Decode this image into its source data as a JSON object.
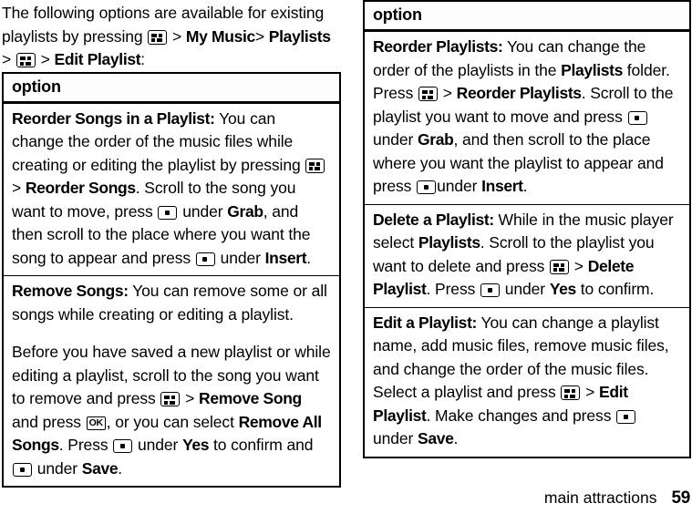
{
  "page": {
    "footer": {
      "chapter": "main attractions",
      "page_number": "59"
    }
  },
  "icons": {
    "menu": "menu-key-icon",
    "center_select": "center-select-key-icon",
    "ok": "ok-key-icon",
    "ok_label": "OK"
  },
  "intro": {
    "t1": "The following options are available for existing playlists by pressing ",
    "t2": " > ",
    "b1": "My Music",
    "t3": "> ",
    "b2": "Playlists",
    "t4": " > ",
    "t5": " > ",
    "b3": "Edit Playlist",
    "t6": ":"
  },
  "tables": {
    "left": {
      "header": "option",
      "rows": [
        {
          "title": "Reorder Songs in a Playlist:",
          "paragraphs": [
            {
              "parts": [
                {
                  "type": "text",
                  "value": " You can change the order of the music files while creating or editing the playlist by pressing "
                },
                {
                  "type": "icon",
                  "value": "menu"
                },
                {
                  "type": "text",
                  "value": " > "
                },
                {
                  "type": "bold",
                  "value": "Reorder Songs"
                },
                {
                  "type": "text",
                  "value": ". Scroll to the song you want to move, press "
                },
                {
                  "type": "icon",
                  "value": "center_select"
                },
                {
                  "type": "text",
                  "value": " under "
                },
                {
                  "type": "bold",
                  "value": "Grab"
                },
                {
                  "type": "text",
                  "value": ", and then scroll to the place where you want the song to appear and press "
                },
                {
                  "type": "icon",
                  "value": "center_select"
                },
                {
                  "type": "text",
                  "value": " under "
                },
                {
                  "type": "bold",
                  "value": "Insert"
                },
                {
                  "type": "text",
                  "value": "."
                }
              ]
            }
          ]
        },
        {
          "title": "Remove Songs:",
          "paragraphs": [
            {
              "parts": [
                {
                  "type": "text",
                  "value": " You can remove some or all songs while creating or editing a playlist."
                }
              ]
            },
            {
              "parts": [
                {
                  "type": "text",
                  "value": "Before you have saved a new playlist or while editing a playlist, scroll to the song you want to remove and press "
                },
                {
                  "type": "icon",
                  "value": "menu"
                },
                {
                  "type": "text",
                  "value": " > "
                },
                {
                  "type": "bold",
                  "value": "Remove Song"
                },
                {
                  "type": "text",
                  "value": " and press "
                },
                {
                  "type": "icon",
                  "value": "ok"
                },
                {
                  "type": "text",
                  "value": ", or you can select "
                },
                {
                  "type": "bold",
                  "value": "Remove All Songs"
                },
                {
                  "type": "text",
                  "value": ". Press "
                },
                {
                  "type": "icon",
                  "value": "center_select"
                },
                {
                  "type": "text",
                  "value": " under "
                },
                {
                  "type": "bold",
                  "value": "Yes"
                },
                {
                  "type": "text",
                  "value": " to confirm and "
                },
                {
                  "type": "icon",
                  "value": "center_select"
                },
                {
                  "type": "text",
                  "value": " under "
                },
                {
                  "type": "bold",
                  "value": "Save"
                },
                {
                  "type": "text",
                  "value": "."
                }
              ]
            }
          ]
        }
      ]
    },
    "right": {
      "header": "option",
      "rows": [
        {
          "title": "Reorder Playlists:",
          "paragraphs": [
            {
              "parts": [
                {
                  "type": "text",
                  "value": " You can change the order of the playlists in the "
                },
                {
                  "type": "bold",
                  "value": "Playlists"
                },
                {
                  "type": "text",
                  "value": " folder. Press "
                },
                {
                  "type": "icon",
                  "value": "menu"
                },
                {
                  "type": "text",
                  "value": " > "
                },
                {
                  "type": "bold",
                  "value": "Reorder Playlists"
                },
                {
                  "type": "text",
                  "value": ". Scroll to the playlist you want to move and press "
                },
                {
                  "type": "icon",
                  "value": "center_select"
                },
                {
                  "type": "text",
                  "value": " under "
                },
                {
                  "type": "bold",
                  "value": "Grab"
                },
                {
                  "type": "text",
                  "value": ", and then scroll to the place where you want the playlist to appear and press "
                },
                {
                  "type": "icon",
                  "value": "center_select"
                },
                {
                  "type": "text",
                  "value": "under "
                },
                {
                  "type": "bold",
                  "value": "Insert"
                },
                {
                  "type": "text",
                  "value": "."
                }
              ]
            }
          ]
        },
        {
          "title": "Delete a Playlist:",
          "paragraphs": [
            {
              "parts": [
                {
                  "type": "text",
                  "value": " While in the music player select "
                },
                {
                  "type": "bold",
                  "value": "Playlists"
                },
                {
                  "type": "text",
                  "value": ". Scroll to the playlist you want to delete and press "
                },
                {
                  "type": "icon",
                  "value": "menu"
                },
                {
                  "type": "text",
                  "value": " > "
                },
                {
                  "type": "bold",
                  "value": "Delete Playlist"
                },
                {
                  "type": "text",
                  "value": ". Press "
                },
                {
                  "type": "icon",
                  "value": "center_select"
                },
                {
                  "type": "text",
                  "value": " under "
                },
                {
                  "type": "bold",
                  "value": "Yes"
                },
                {
                  "type": "text",
                  "value": " to confirm."
                }
              ]
            }
          ]
        },
        {
          "title": "Edit a Playlist:",
          "paragraphs": [
            {
              "parts": [
                {
                  "type": "text",
                  "value": " You can change a playlist name, add music files, remove music files, and change the order of the music files. Select a playlist and press "
                },
                {
                  "type": "icon",
                  "value": "menu"
                },
                {
                  "type": "text",
                  "value": " > "
                },
                {
                  "type": "bold",
                  "value": "Edit Playlist"
                },
                {
                  "type": "text",
                  "value": ". Make changes and press "
                },
                {
                  "type": "icon",
                  "value": "center_select"
                },
                {
                  "type": "text",
                  "value": " under "
                },
                {
                  "type": "bold",
                  "value": "Save"
                },
                {
                  "type": "text",
                  "value": "."
                }
              ]
            }
          ]
        }
      ]
    }
  }
}
